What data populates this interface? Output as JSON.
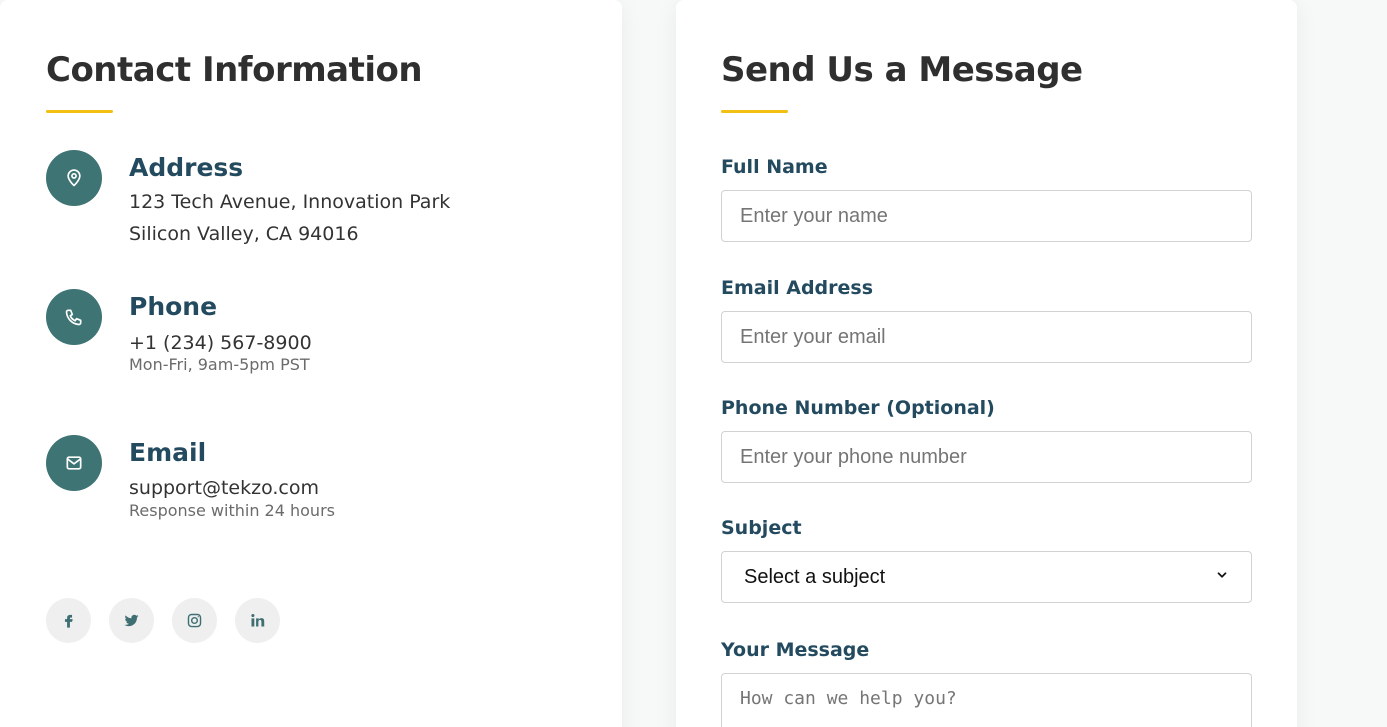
{
  "contact": {
    "title": "Contact Information",
    "address": {
      "icon": "map-pin-icon",
      "heading": "Address",
      "line1": "123 Tech Avenue, Innovation Park",
      "line2": "Silicon Valley, CA 94016"
    },
    "phone": {
      "icon": "phone-icon",
      "heading": "Phone",
      "number": "+1 (234) 567-8900",
      "hours": "Mon-Fri, 9am-5pm PST"
    },
    "email": {
      "icon": "mail-icon",
      "heading": "Email",
      "address": "support@tekzo.com",
      "response": "Response within 24 hours"
    },
    "social": [
      "facebook-icon",
      "twitter-icon",
      "instagram-icon",
      "linkedin-icon"
    ]
  },
  "form": {
    "title": "Send Us a Message",
    "full_name": {
      "label": "Full Name",
      "placeholder": "Enter your name",
      "value": ""
    },
    "email": {
      "label": "Email Address",
      "placeholder": "Enter your email",
      "value": ""
    },
    "phone": {
      "label": "Phone Number (Optional)",
      "placeholder": "Enter your phone number",
      "value": ""
    },
    "subject": {
      "label": "Subject",
      "selected": "Select a subject"
    },
    "message": {
      "label": "Your Message",
      "placeholder": "How can we help you?",
      "value": ""
    }
  },
  "colors": {
    "accent": "#f2c012",
    "icon_circle": "#3f7474",
    "heading": "#234a5f",
    "social_bg": "#efefef"
  }
}
